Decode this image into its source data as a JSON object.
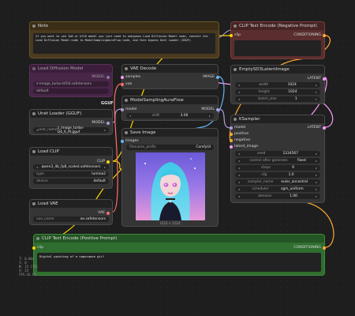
{
  "colors": {
    "model": "#b39ddb",
    "clip": "#ffd500",
    "vae": "#ff6e6e",
    "conditioning": "#ffa931",
    "latent": "#ff9cf9",
    "image": "#64b5f6",
    "float": "#aaaaaa",
    "int": "#aaee88",
    "green": "#2f6e2f",
    "brown": "#4a3a1e",
    "red": "#5a2e2e",
    "purple": "#5b2a5b"
  },
  "note": {
    "title": "Note",
    "text": "If you want to use fp8 or bf16 model you just need to unbypass Load Diffusion Model node, connect the Load Diffusion Model node to ModelSamplingAuraFlow node, and then bypass Unet Loader (GGUF)."
  },
  "load_diffusion": {
    "title": "Load Diffusion Model",
    "output": "MODEL",
    "unet_name": "z-image_turbo-bf16.safetensors",
    "weight_dtype": "default"
  },
  "gguf_label": "GGUF",
  "unet_gguf": {
    "title": "Unet Loader (GGUF)",
    "output": "MODEL",
    "label": "unet_name",
    "value": "z_image_turbo-Q4_K_M.gguf"
  },
  "load_clip": {
    "title": "Load CLIP",
    "output": "CLIP",
    "clip_name": "qwen3_4b_fp8_scaled.safetensors",
    "type_label": "type",
    "type": "lumina2",
    "device_label": "device",
    "device": "default"
  },
  "load_vae": {
    "title": "Load VAE",
    "output": "VAE",
    "label": "vae_name",
    "value": "ae.safetensors"
  },
  "vae_decode": {
    "title": "VAE Decode",
    "in1": "samples",
    "in2": "vae",
    "output": "IMAGE"
  },
  "model_sampling": {
    "title": "ModelSamplingAuraFlow",
    "input": "model",
    "output": "MODEL",
    "shift_label": "shift",
    "shift": "3.00"
  },
  "save_image": {
    "title": "Save Image",
    "input": "images",
    "prefix_label": "filename_prefix",
    "prefix": "ComfyUI",
    "image_size": "1024 × 1024"
  },
  "clip_neg": {
    "title": "CLIP Text Encode (Negative Prompt)",
    "input": "clip",
    "output": "CONDITIONING"
  },
  "empty_latent": {
    "title": "EmptySD3LatentImage",
    "output": "LATENT",
    "width_label": "width",
    "width": "1024",
    "height_label": "height",
    "height": "1024",
    "batch_label": "batch_size",
    "batch": "1"
  },
  "ksampler": {
    "title": "KSampler",
    "inputs": [
      "model",
      "positive",
      "negative",
      "latent_image"
    ],
    "output": "LATENT",
    "widgets": [
      {
        "label": "seed",
        "value": "1234567"
      },
      {
        "label": "control after generate",
        "value": "fixed"
      },
      {
        "label": "steps",
        "value": "9"
      },
      {
        "label": "cfg",
        "value": "1.0"
      },
      {
        "label": "sampler_name",
        "value": "euler_ancestral"
      },
      {
        "label": "scheduler",
        "value": "sgm_uniform"
      },
      {
        "label": "denoise",
        "value": "1.00"
      }
    ]
  },
  "clip_pos": {
    "title": "CLIP Text Encode (Positive Prompt)",
    "input": "clip",
    "output": "CONDITIONING",
    "text": "Digital painting of a vaporwave girl"
  },
  "stats": [
    "T: 0.00s",
    "I: 0",
    "N: 15 [15]",
    "V: 24",
    "FPS:16.62"
  ]
}
